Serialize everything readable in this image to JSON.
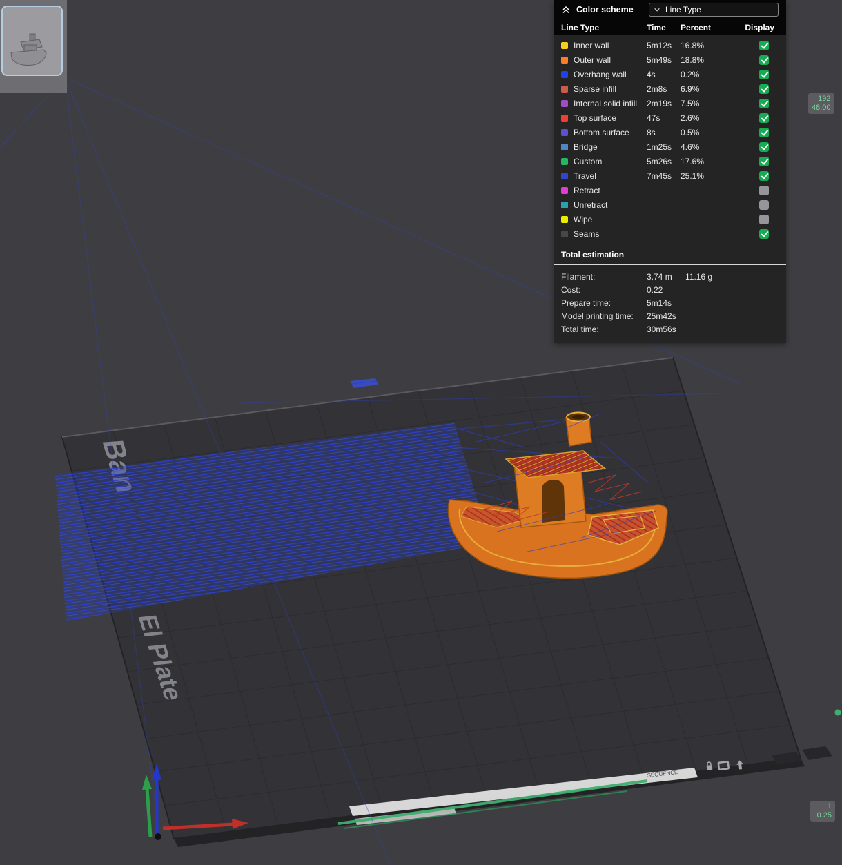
{
  "panel": {
    "title": "Color scheme",
    "dropdown_value": "Line Type",
    "columns": {
      "type": "Line Type",
      "time": "Time",
      "percent": "Percent",
      "display": "Display"
    },
    "rows": [
      {
        "label": "Inner wall",
        "color": "#f5cf1b",
        "time": "5m12s",
        "percent": "16.8%",
        "display": true
      },
      {
        "label": "Outer wall",
        "color": "#fd7c25",
        "time": "5m49s",
        "percent": "18.8%",
        "display": true
      },
      {
        "label": "Overhang wall",
        "color": "#2043e8",
        "time": "4s",
        "percent": "0.2%",
        "display": true
      },
      {
        "label": "Sparse infill",
        "color": "#cc5b4c",
        "time": "2m8s",
        "percent": "6.9%",
        "display": true
      },
      {
        "label": "Internal solid infill",
        "color": "#9d4fc0",
        "time": "2m19s",
        "percent": "7.5%",
        "display": true
      },
      {
        "label": "Top surface",
        "color": "#f03e35",
        "time": "47s",
        "percent": "2.6%",
        "display": true
      },
      {
        "label": "Bottom surface",
        "color": "#5a50d2",
        "time": "8s",
        "percent": "0.5%",
        "display": true
      },
      {
        "label": "Bridge",
        "color": "#4e87c3",
        "time": "1m25s",
        "percent": "4.6%",
        "display": true
      },
      {
        "label": "Custom",
        "color": "#26b465",
        "time": "5m26s",
        "percent": "17.6%",
        "display": true
      },
      {
        "label": "Travel",
        "color": "#3344cc",
        "time": "7m45s",
        "percent": "25.1%",
        "display": true
      },
      {
        "label": "Retract",
        "color": "#e23bd6",
        "time": "",
        "percent": "",
        "display": false
      },
      {
        "label": "Unretract",
        "color": "#2aa2ac",
        "time": "",
        "percent": "",
        "display": false
      },
      {
        "label": "Wipe",
        "color": "#ecec00",
        "time": "",
        "percent": "",
        "display": false
      },
      {
        "label": "Seams",
        "color": "#47474a",
        "time": "",
        "percent": "",
        "display": true
      }
    ],
    "total": {
      "heading": "Total estimation",
      "rows": [
        {
          "label": "Filament:",
          "value": "3.74 m",
          "value2": "11.16 g"
        },
        {
          "label": "Cost:",
          "value": "0.22"
        },
        {
          "label": "Prepare time:",
          "value": "5m14s"
        },
        {
          "label": "Model printing time:",
          "value": "25m42s"
        },
        {
          "label": "Total time:",
          "value": "30m56s"
        }
      ]
    }
  },
  "badges": {
    "layer": {
      "line1": "192",
      "line2": "48.00"
    },
    "step": {
      "line1": "1",
      "line2": "0.25"
    }
  },
  "plate": {
    "label_fragment_top": "Ban",
    "label_fragment_bottom": "El Plate",
    "sequence_label": "SEQUENCE"
  },
  "icons": {
    "collapse": "double-chevron-up-icon",
    "dropdown": "chevron-down-icon"
  },
  "colors": {
    "checkbox_checked": "#17ab52",
    "badge_text": "#79d69c",
    "travel_blue": "#2b3fd2",
    "model_orange": "#d9731f",
    "axis_x": "#c03028",
    "axis_y": "#2aa04a",
    "axis_z": "#2338c8"
  }
}
